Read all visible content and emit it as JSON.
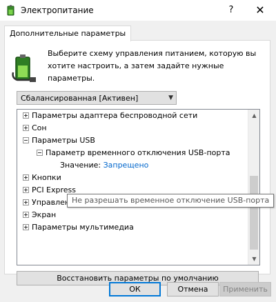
{
  "window": {
    "title": "Электропитание",
    "help_label": "?",
    "close_label": "✕"
  },
  "tab": {
    "label": "Дополнительные параметры"
  },
  "intro_text": "Выберите схему управления питанием, которую вы хотите настроить, а затем задайте нужные параметры.",
  "plan_select": {
    "value": "Сбалансированная [Активен]"
  },
  "tree": {
    "items": [
      {
        "label": "Параметры адаптера беспроводной сети",
        "expander": "+"
      },
      {
        "label": "Сон",
        "expander": "+"
      },
      {
        "label": "Параметры USB",
        "expander": "-"
      },
      {
        "label": "Параметр временного отключения USB-порта",
        "expander": "-"
      },
      {
        "value_label": "Значение:",
        "value": "Запрещено"
      },
      {
        "label": "Кнопки",
        "expander": "+"
      },
      {
        "label": "PCI Express",
        "expander": "+"
      },
      {
        "label": "Управление питанием процессора",
        "expander": "+"
      },
      {
        "label": "Экран",
        "expander": "+"
      },
      {
        "label": "Параметры мультимедиа",
        "expander": "+"
      }
    ]
  },
  "tooltip": "Не разрешать временное отключение USB-порта",
  "restore_button": "Восстановить параметры по умолчанию",
  "buttons": {
    "ok": "ОК",
    "cancel": "Отмена",
    "apply": "Применить"
  },
  "colors": {
    "accent": "#0078d7",
    "link": "#0066cc"
  }
}
